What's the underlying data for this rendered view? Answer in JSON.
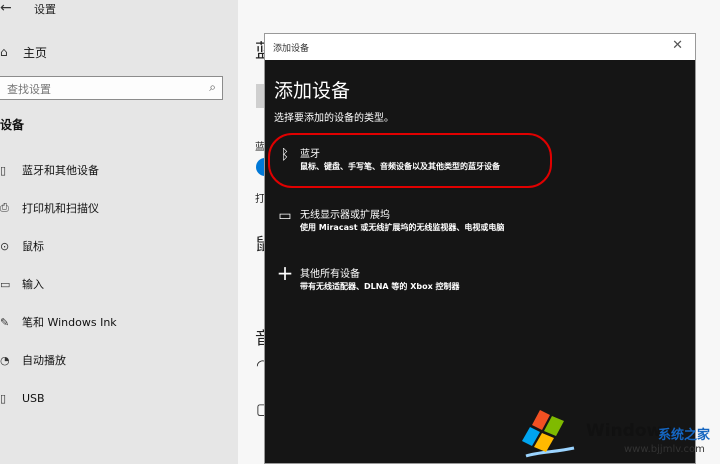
{
  "window": {
    "title": "设置"
  },
  "nav": {
    "home": "主页",
    "search_placeholder": "查找设置",
    "section": "设备",
    "items": [
      {
        "label": "蓝牙和其他设备",
        "icon": "bluetooth-icon"
      },
      {
        "label": "打印机和扫描仪",
        "icon": "printer-icon"
      },
      {
        "label": "鼠标",
        "icon": "mouse-icon"
      },
      {
        "label": "输入",
        "icon": "keyboard-icon"
      },
      {
        "label": "笔和 Windows Ink",
        "icon": "pen-icon"
      },
      {
        "label": "自动播放",
        "icon": "autoplay-icon"
      },
      {
        "label": "USB",
        "icon": "usb-icon"
      }
    ]
  },
  "main_fragments": [
    "蓝",
    "蓝",
    "打",
    "鼠",
    "音"
  ],
  "dialog": {
    "titlebar": "添加设备",
    "heading": "添加设备",
    "subtitle": "选择要添加的设备的类型。",
    "options": [
      {
        "title": "蓝牙",
        "desc": "鼠标、键盘、手写笔、音频设备以及其他类型的蓝牙设备",
        "icon": "bluetooth-icon"
      },
      {
        "title": "无线显示器或扩展坞",
        "desc": "使用 Miracast 或无线扩展坞的无线监视器、电视或电脑",
        "icon": "monitor-icon"
      },
      {
        "title": "其他所有设备",
        "desc": "带有无线适配器、DLNA 等的 Xbox 控制器",
        "icon": "plus-icon"
      }
    ]
  },
  "watermark": {
    "brand": "Windows",
    "cn": "系统之家",
    "url": "www.bjjmlv.com"
  },
  "colors": {
    "accent": "#0078d7",
    "annotation": "#e00000",
    "dialog_bg": "#151515"
  }
}
